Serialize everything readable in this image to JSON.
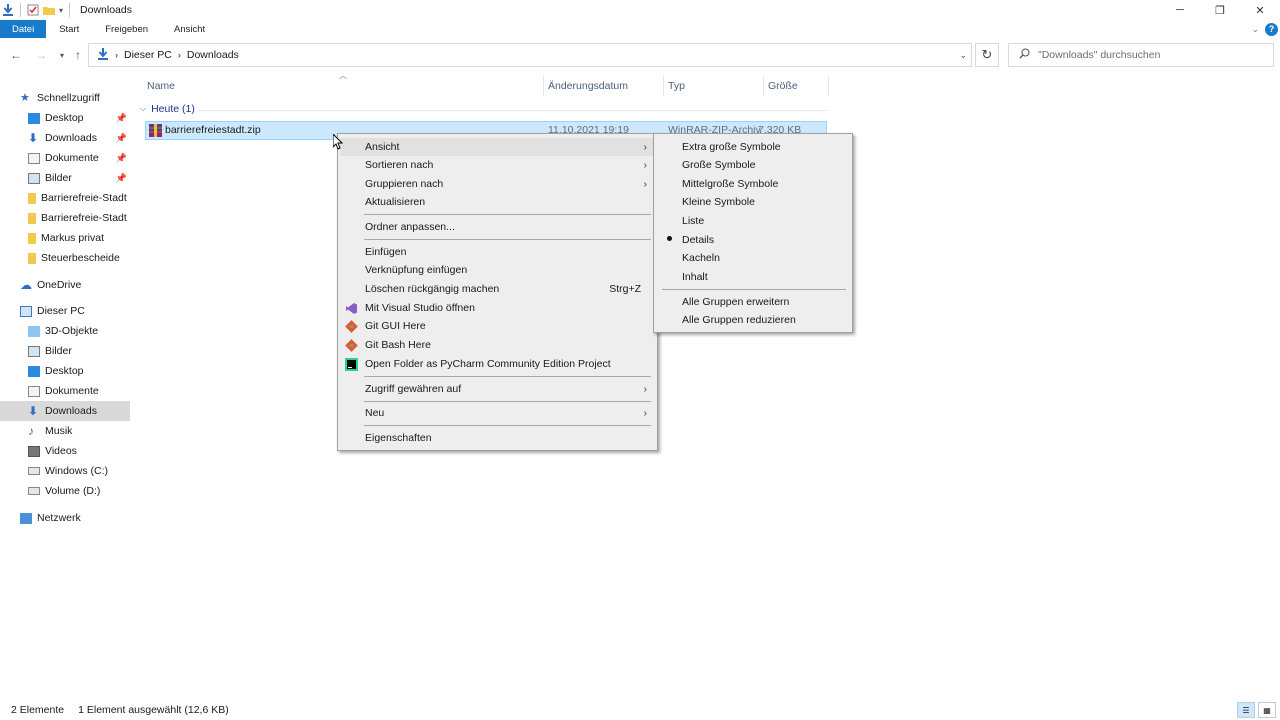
{
  "window": {
    "title": "Downloads"
  },
  "ribbon": {
    "tabs": [
      "Datei",
      "Start",
      "Freigeben",
      "Ansicht"
    ]
  },
  "address": {
    "crumbs": [
      "Dieser PC",
      "Downloads"
    ]
  },
  "search": {
    "placeholder": "\"Downloads\" durchsuchen"
  },
  "sidebar": {
    "quick_access": "Schnellzugriff",
    "quick_items": [
      "Desktop",
      "Downloads",
      "Dokumente",
      "Bilder",
      "Barrierefreie-Stadt",
      "Barrierefreie-Stadt",
      "Markus privat",
      "Steuerbescheide"
    ],
    "onedrive": "OneDrive",
    "this_pc": "Dieser PC",
    "pc_items": [
      "3D-Objekte",
      "Bilder",
      "Desktop",
      "Dokumente",
      "Downloads",
      "Musik",
      "Videos",
      "Windows (C:)",
      "Volume (D:)"
    ],
    "network": "Netzwerk"
  },
  "columns": {
    "name": "Name",
    "date": "Änderungsdatum",
    "type": "Typ",
    "size": "Größe"
  },
  "group": {
    "label": "Heute (1)"
  },
  "file": {
    "name": "barrierefreiestadt.zip",
    "date": "11.10.2021 19:19",
    "type": "WinRAR-ZIP-Archiv",
    "size": "7.320 KB"
  },
  "context_menu": {
    "view": "Ansicht",
    "sort_by": "Sortieren nach",
    "group_by": "Gruppieren nach",
    "refresh": "Aktualisieren",
    "customize": "Ordner anpassen...",
    "paste": "Einfügen",
    "paste_shortcut": "Verknüpfung einfügen",
    "undo_delete": "Löschen rückgängig machen",
    "undo_shortcut": "Strg+Z",
    "open_vs": "Mit Visual Studio öffnen",
    "git_gui": "Git GUI Here",
    "git_bash": "Git Bash Here",
    "pycharm": "Open Folder as PyCharm Community Edition Project",
    "give_access": "Zugriff gewähren auf",
    "new": "Neu",
    "properties": "Eigenschaften"
  },
  "view_submenu": {
    "items": [
      "Extra große Symbole",
      "Große Symbole",
      "Mittelgroße Symbole",
      "Kleine Symbole",
      "Liste",
      "Details",
      "Kacheln",
      "Inhalt"
    ],
    "selected": "Details",
    "expand_groups": "Alle Gruppen erweitern",
    "collapse_groups": "Alle Gruppen reduzieren"
  },
  "status": {
    "count": "2 Elemente",
    "selection": "1 Element ausgewählt (12,6 KB)"
  },
  "colors": {
    "accent": "#1979ca",
    "selection": "#cce8ff",
    "folder": "#f3c94a"
  }
}
